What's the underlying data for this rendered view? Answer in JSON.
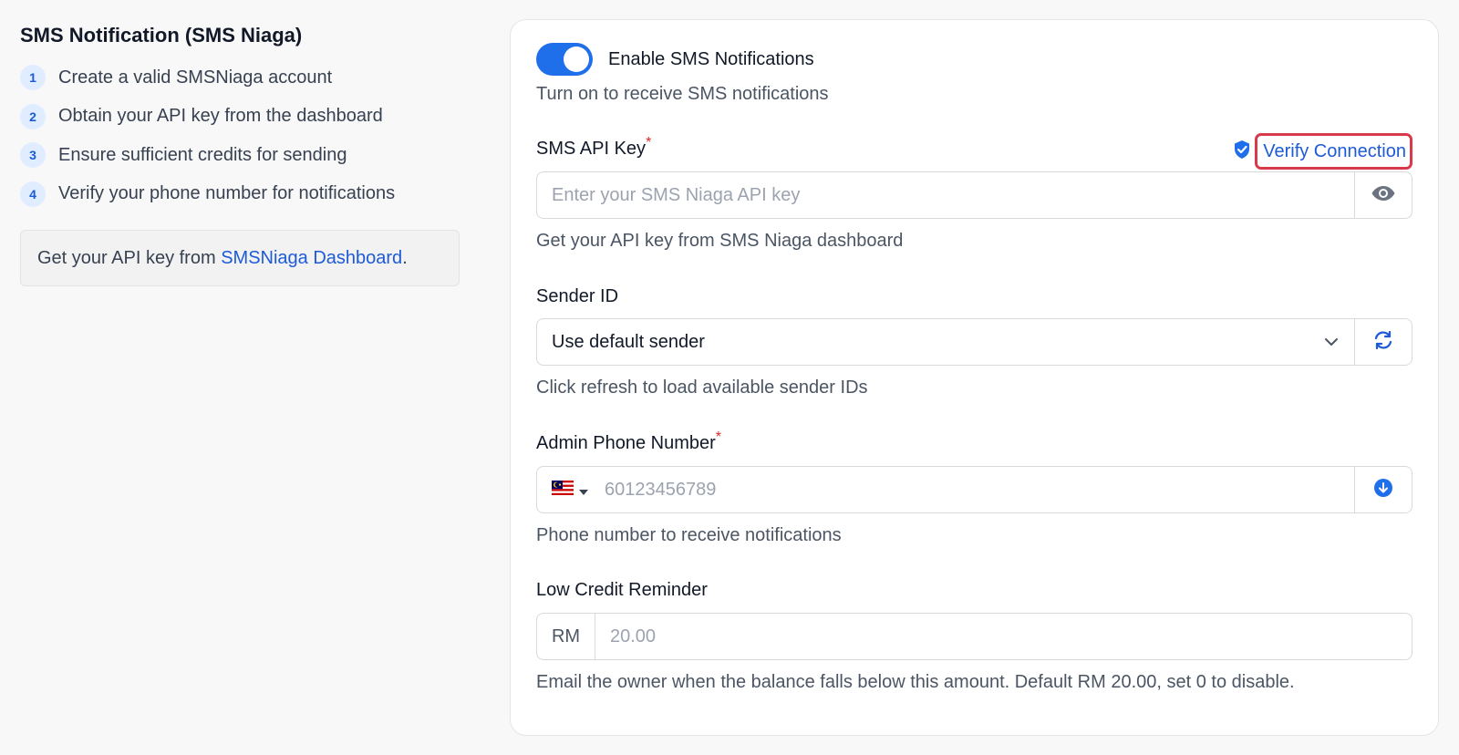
{
  "left": {
    "title": "SMS Notification (SMS Niaga)",
    "steps": [
      {
        "num": "1",
        "text": "Create a valid SMSNiaga account"
      },
      {
        "num": "2",
        "text": "Obtain your API key from the dashboard"
      },
      {
        "num": "3",
        "text": "Ensure sufficient credits for sending"
      },
      {
        "num": "4",
        "text": "Verify your phone number for notifications"
      }
    ],
    "api_box": {
      "prefix": "Get your API key from ",
      "link": "SMSNiaga Dashboard",
      "suffix": "."
    }
  },
  "toggle": {
    "label": "Enable SMS Notifications",
    "help": "Turn on to receive SMS notifications",
    "on": true
  },
  "api_key": {
    "label": "SMS API Key",
    "required": "*",
    "verify_label": "Verify Connection",
    "placeholder": "Enter your SMS Niaga API key",
    "help": "Get your API key from SMS Niaga dashboard"
  },
  "sender": {
    "label": "Sender ID",
    "value": "Use default sender",
    "help": "Click refresh to load available sender IDs"
  },
  "phone": {
    "label": "Admin Phone Number",
    "required": "*",
    "placeholder": "60123456789",
    "help": "Phone number to receive notifications"
  },
  "credit": {
    "label": "Low Credit Reminder",
    "currency": "RM",
    "placeholder": "20.00",
    "help": "Email the owner when the balance falls below this amount. Default RM 20.00, set 0 to disable."
  },
  "colors": {
    "accent": "#1f6feb",
    "link": "#1d5ad8",
    "highlight": "#d93a4b"
  }
}
